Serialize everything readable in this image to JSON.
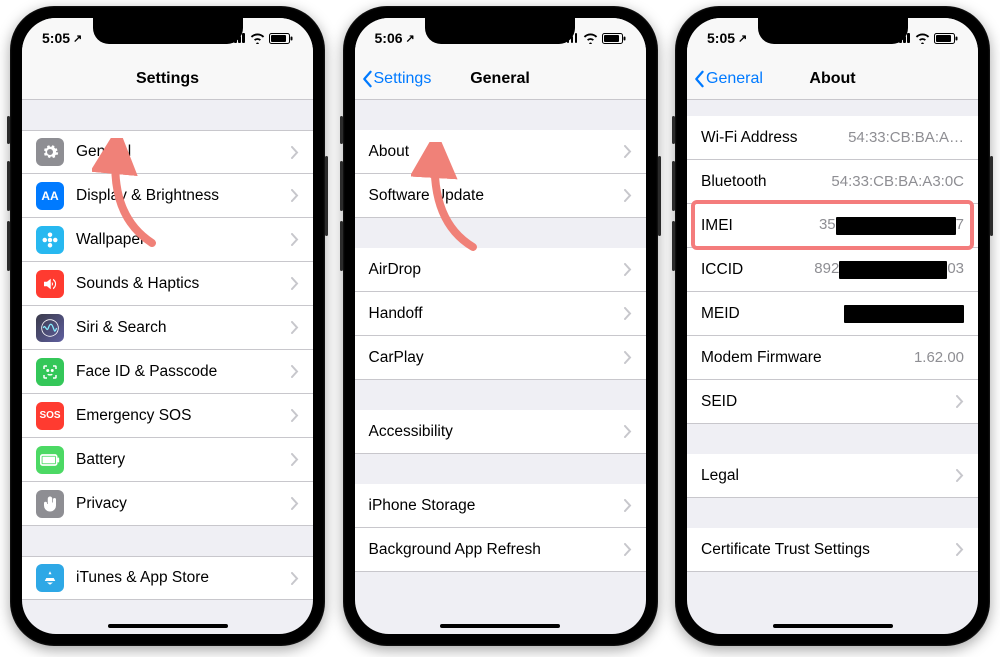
{
  "status": {
    "time1": "5:05",
    "time2": "5:06",
    "time3": "5:05",
    "loc_arrow": "↗"
  },
  "screen1": {
    "title": "Settings",
    "rows": [
      {
        "label": "General",
        "icon": "gear",
        "bg": "bg-gray"
      },
      {
        "label": "Display & Brightness",
        "icon": "AA",
        "bg": "bg-blue"
      },
      {
        "label": "Wallpaper",
        "icon": "flower",
        "bg": "bg-cyan"
      },
      {
        "label": "Sounds & Haptics",
        "icon": "speaker",
        "bg": "bg-red"
      },
      {
        "label": "Siri & Search",
        "icon": "siri",
        "bg": "bg-purple"
      },
      {
        "label": "Face ID & Passcode",
        "icon": "face",
        "bg": "bg-green"
      },
      {
        "label": "Emergency SOS",
        "icon": "SOS",
        "bg": "bg-red"
      },
      {
        "label": "Battery",
        "icon": "battery",
        "bg": "bg-green2"
      },
      {
        "label": "Privacy",
        "icon": "hand",
        "bg": "bg-gray"
      }
    ],
    "lastRow": {
      "label": "iTunes & App Store",
      "icon": "appstore",
      "bg": "bg-sky"
    }
  },
  "screen2": {
    "back": "Settings",
    "title": "General",
    "groups": [
      [
        "About",
        "Software Update"
      ],
      [
        "AirDrop",
        "Handoff",
        "CarPlay"
      ],
      [
        "Accessibility"
      ],
      [
        "iPhone Storage",
        "Background App Refresh"
      ]
    ]
  },
  "screen3": {
    "back": "General",
    "title": "About",
    "rows": [
      {
        "label": "Wi-Fi Address",
        "value": "54:33:CB:BA:A…"
      },
      {
        "label": "Bluetooth",
        "value": "54:33:CB:BA:A3:0C"
      },
      {
        "label": "IMEI",
        "value": "35",
        "redact_w": 120,
        "tail": "7",
        "highlight": true
      },
      {
        "label": "ICCID",
        "value": "892",
        "redact_w": 108,
        "tail": "03"
      },
      {
        "label": "MEID",
        "value": "",
        "redact_w": 120,
        "tail": ""
      },
      {
        "label": "Modem Firmware",
        "value": "1.62.00"
      },
      {
        "label": "SEID",
        "chevron": true
      }
    ],
    "legal": "Legal",
    "cts": "Certificate Trust Settings"
  }
}
